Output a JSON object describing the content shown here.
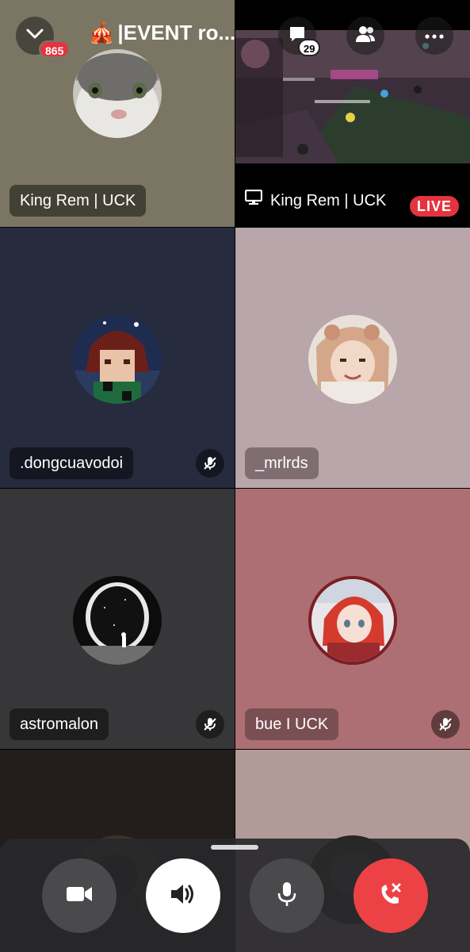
{
  "header": {
    "notification_count": "865",
    "channel_emoji": "🎪",
    "channel_title": "|EVENT ro...",
    "chat_count": "29"
  },
  "participants": [
    {
      "name": "King Rem | UCK",
      "muted": false
    },
    {
      "name": "King Rem | UCK",
      "stream": true,
      "live_label": "LIVE"
    },
    {
      "name": ".dongcuavodoi",
      "muted": true
    },
    {
      "name": "_mrlrds",
      "muted": false
    },
    {
      "name": "astromalon",
      "muted": true
    },
    {
      "name": "bue I UCK",
      "muted": true
    }
  ],
  "controls": {
    "camera": "camera-off",
    "speaker": "speaker-on",
    "microphone": "mic",
    "end_call": "disconnect"
  },
  "colors": {
    "live_red": "#e3343f",
    "end_call_red": "#ed4245",
    "control_grey": "#4a4a4c"
  }
}
